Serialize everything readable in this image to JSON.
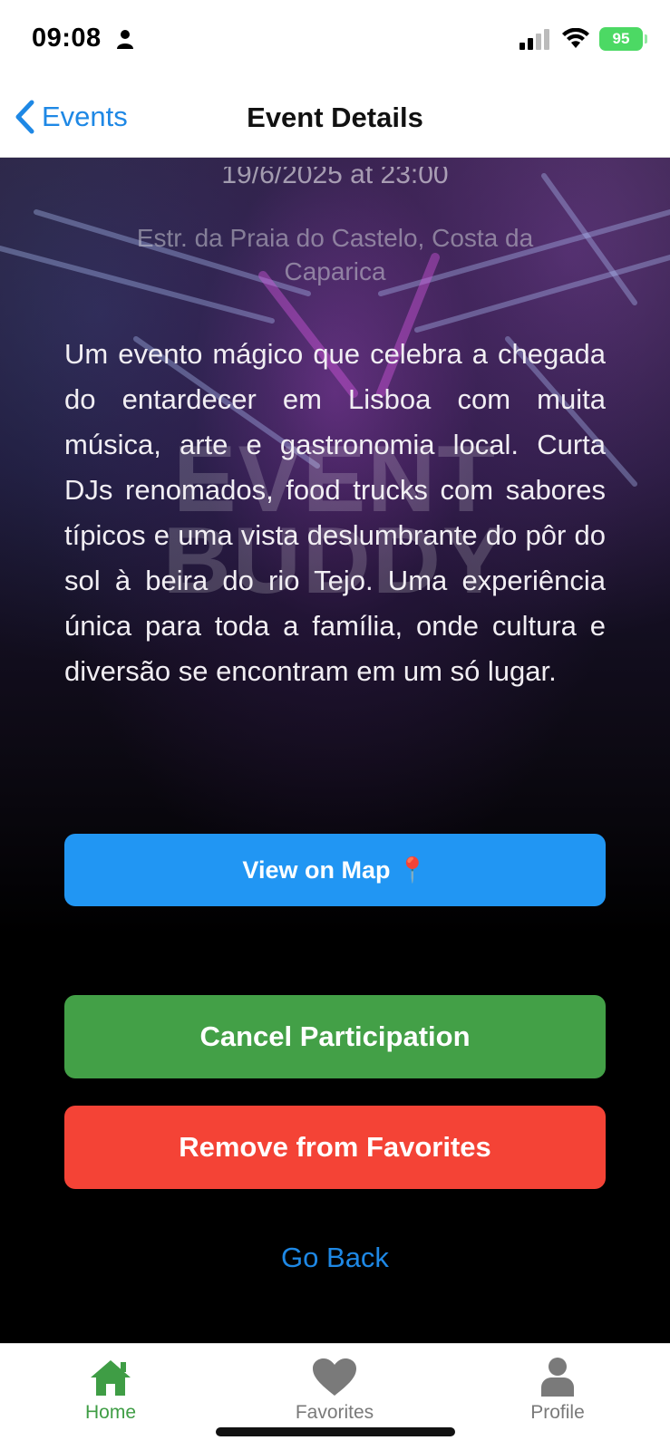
{
  "status_bar": {
    "time": "09:08",
    "battery": "95"
  },
  "nav": {
    "back_label": "Events",
    "title": "Event Details"
  },
  "event": {
    "datetime": "19/6/2025 at 23:00",
    "address": "Estr. da Praia do Castelo,  Costa da Caparica",
    "description": "Um evento mágico que celebra a chegada do entardecer em Lisboa com muita música, arte e gastronomia local. Curta DJs renomados, food trucks com sabores típicos e uma vista deslumbrante do pôr do sol à beira do rio Tejo. Uma experiência única para toda a família, onde cultura e diversão se encontram em um só lugar.",
    "watermark_line1": "EVENT",
    "watermark_line2": "BUDDY"
  },
  "actions": {
    "map_label": "View on Map 📍",
    "cancel_label": "Cancel Participation",
    "remove_label": "Remove from Favorites",
    "go_back_label": "Go Back"
  },
  "tabs": [
    {
      "label": "Home",
      "icon": "home-icon",
      "active": true
    },
    {
      "label": "Favorites",
      "icon": "heart-icon",
      "active": false
    },
    {
      "label": "Profile",
      "icon": "person-icon",
      "active": false
    }
  ],
  "colors": {
    "accent_blue": "#1e88e5",
    "map_button": "#2196f3",
    "cancel_button": "#43a047",
    "remove_button": "#f44336",
    "active_tab": "#3f9d45",
    "battery": "#4cd964"
  }
}
